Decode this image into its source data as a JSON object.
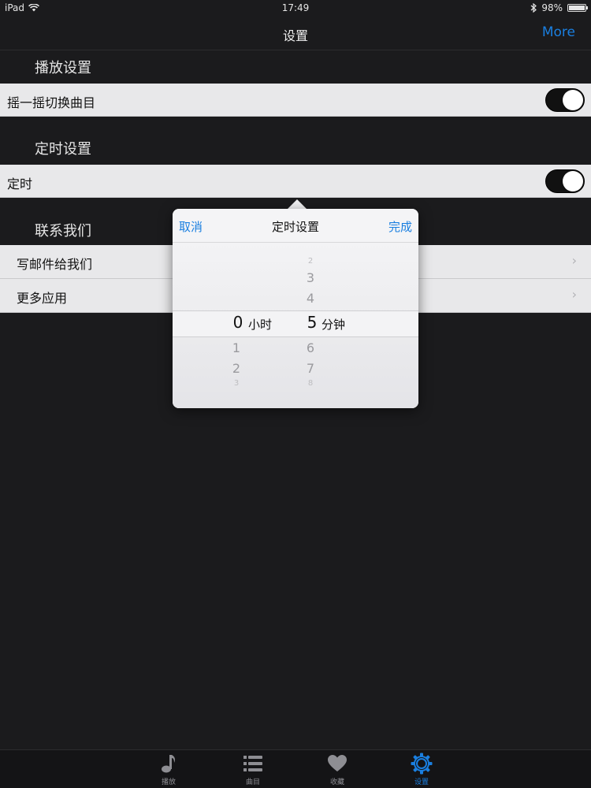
{
  "status": {
    "device": "iPad",
    "time": "17:49",
    "battery": "98%",
    "battery_level": 0.98
  },
  "nav": {
    "title": "设置",
    "more": "More"
  },
  "sections": {
    "playback": {
      "header": "播放设置",
      "row_label": "摇一摇切换曲目",
      "toggle_on": true
    },
    "timer": {
      "header": "定时设置",
      "row_label": "定时",
      "toggle_on": true
    },
    "contact": {
      "header": "联系我们",
      "rows": [
        "写邮件给我们",
        "更多应用"
      ]
    }
  },
  "popover": {
    "cancel": "取消",
    "title": "定时设置",
    "done": "完成",
    "hours": {
      "above": [
        "",
        "",
        ""
      ],
      "selected": "0",
      "unit": "小时",
      "below": [
        "1",
        "2",
        "3"
      ]
    },
    "minutes": {
      "above": [
        "2",
        "3",
        "4"
      ],
      "selected": "5",
      "unit": "分钟",
      "below": [
        "6",
        "7",
        "8"
      ]
    }
  },
  "tabs": [
    {
      "label": "播放",
      "icon": "music-note-icon",
      "active": false
    },
    {
      "label": "曲目",
      "icon": "list-icon",
      "active": false
    },
    {
      "label": "收藏",
      "icon": "heart-icon",
      "active": false
    },
    {
      "label": "设置",
      "icon": "gear-icon",
      "active": true
    }
  ],
  "colors": {
    "accent": "#1a7fe0",
    "background": "#1b1b1d",
    "row": "#e8e8ea"
  }
}
